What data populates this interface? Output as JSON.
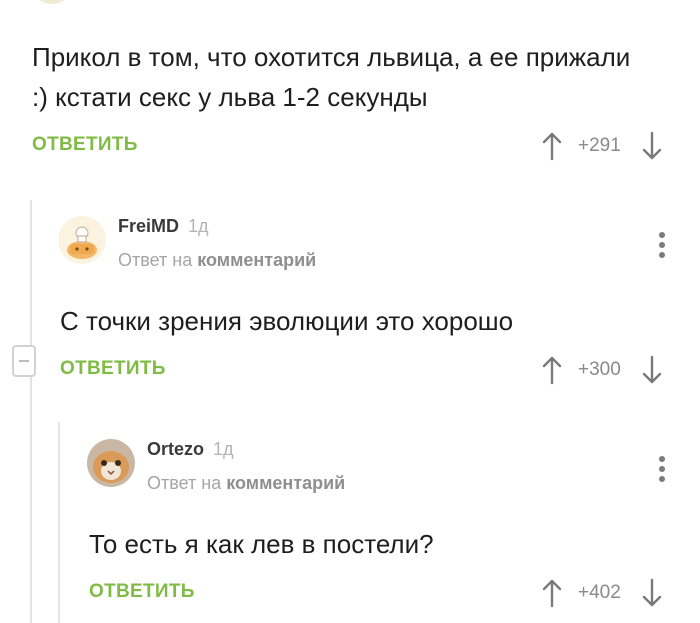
{
  "comments": [
    {
      "text": "Прикол в том, что охотится львица, а ее прижали :) кстати секс у льва 1-2 секунды",
      "reply_label": "ОТВЕТИТЬ",
      "rating": "+291"
    },
    {
      "username": "FreiMD",
      "time": "1д",
      "reply_to_prefix": "Ответ на",
      "reply_to_link": "комментарий",
      "text": "С точки зрения эволюции это хорошо",
      "reply_label": "ОТВЕТИТЬ",
      "rating": "+300"
    },
    {
      "username": "Ortezo",
      "time": "1д",
      "reply_to_prefix": "Ответ на",
      "reply_to_link": "комментарий",
      "text": "То есть я как лев в постели?",
      "reply_label": "ОТВЕТИТЬ",
      "rating": "+402"
    }
  ],
  "colors": {
    "accent_green": "#7fbb45",
    "muted_text": "#8a8a8a",
    "thread_line": "#e3e3e3"
  },
  "icons": {
    "upvote": "arrow-up-icon",
    "downvote": "arrow-down-icon",
    "more": "vertical-dots-icon",
    "collapse": "minus-icon"
  }
}
